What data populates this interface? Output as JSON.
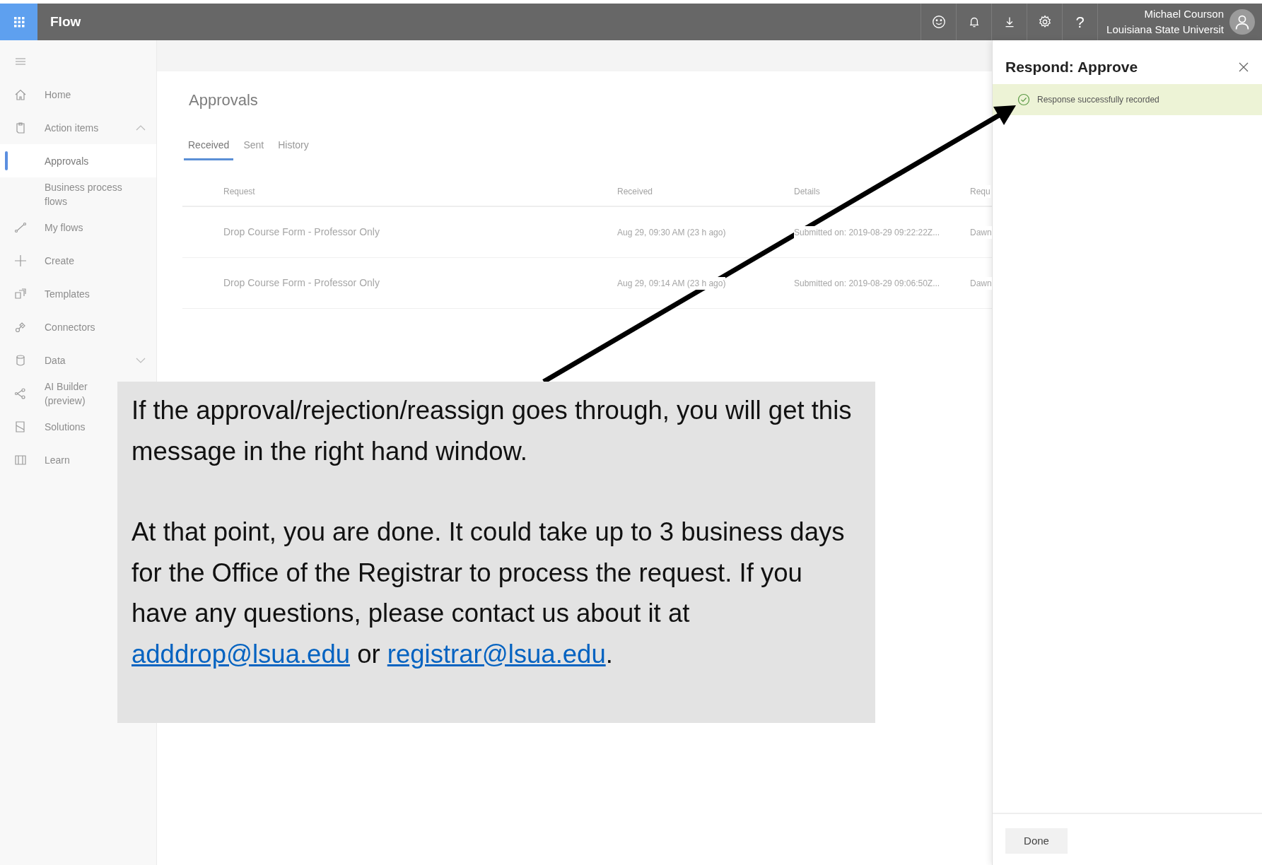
{
  "app_bar": {
    "title": "Flow",
    "help": "?",
    "user_name": "Michael Courson",
    "organization": "Louisiana State Universit"
  },
  "sidebar": {
    "items": [
      {
        "kind": "link",
        "label": "Home",
        "selected": false
      },
      {
        "kind": "group",
        "label": "Action items",
        "selected": false,
        "expanded": true,
        "children": [
          {
            "label": "Approvals",
            "selected": true
          },
          {
            "label": "Business process flows",
            "selected": false
          }
        ]
      },
      {
        "kind": "link",
        "label": "My flows",
        "selected": false
      },
      {
        "kind": "link",
        "label": "Create",
        "selected": false
      },
      {
        "kind": "link",
        "label": "Templates",
        "selected": false
      },
      {
        "kind": "link",
        "label": "Connectors",
        "selected": false
      },
      {
        "kind": "group",
        "label": "Data",
        "selected": false,
        "expanded": false
      },
      {
        "kind": "link",
        "label": "AI Builder (preview)",
        "selected": false
      },
      {
        "kind": "link",
        "label": "Solutions",
        "selected": false
      },
      {
        "kind": "link",
        "label": "Learn",
        "selected": false
      }
    ]
  },
  "page": {
    "title": "Approvals",
    "tabs": [
      {
        "label": "Received",
        "selected": true
      },
      {
        "label": "Sent",
        "selected": false
      },
      {
        "label": "History",
        "selected": false
      }
    ],
    "table": {
      "columns": [
        "Request",
        "Received",
        "Details",
        "Requ"
      ],
      "rows": [
        [
          "Drop Course Form - Professor Only",
          "Aug 29, 09:30 AM (23 h ago)",
          "Submitted on: 2019-08-29 09:22:22Z...",
          "Dawn"
        ],
        [
          "Drop Course Form - Professor Only",
          "Aug 29, 09:14 AM (23 h ago)",
          "Submitted on: 2019-08-29 09:06:50Z...",
          "Dawn"
        ]
      ]
    }
  },
  "panel": {
    "title": "Respond: Approve",
    "message": "Response successfully recorded",
    "buttons": [
      "Done"
    ]
  },
  "callout": {
    "paragraphs": [
      [
        {
          "kind": "text",
          "text": "If the approval/rejection/reassign goes through, you will get this message in the right hand window."
        }
      ],
      [
        {
          "kind": "text",
          "text": "At that point, you are done. It could take up to 3 business days for the Office of the Registrar to process the request. If you have any questions, please contact us about it at "
        },
        {
          "kind": "link",
          "text": "adddrop@lsua.edu"
        },
        {
          "kind": "text",
          "text": " or "
        },
        {
          "kind": "link",
          "text": "registrar@lsua.edu"
        },
        {
          "kind": "text",
          "text": "."
        }
      ]
    ]
  }
}
